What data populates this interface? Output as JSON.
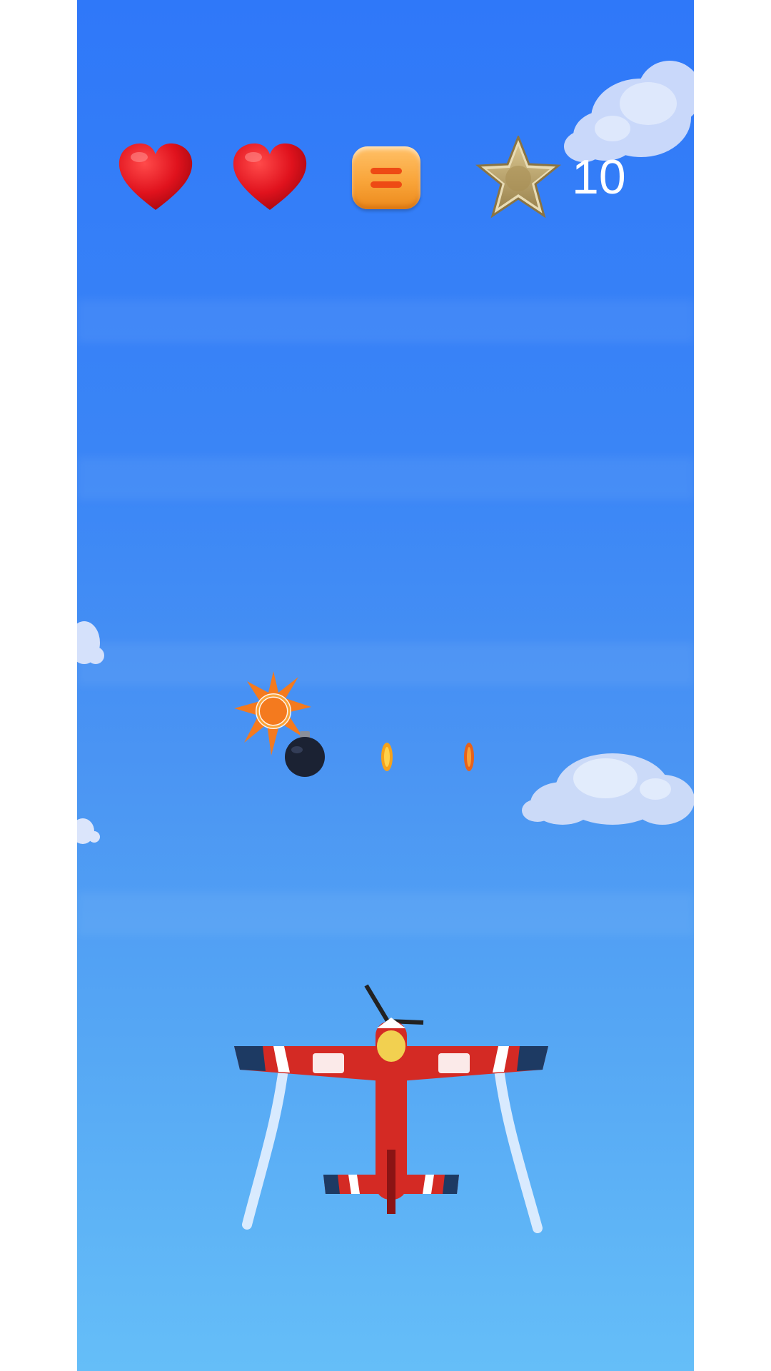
{
  "hud": {
    "lives": [
      {
        "name": "heart-icon-1"
      },
      {
        "name": "heart-icon-2"
      }
    ],
    "pause_icon": "pause-menu-icon",
    "star_icon": "star-badge-icon",
    "score": "10"
  },
  "colors": {
    "sky_top": "#2f78f9",
    "sky_bottom": "#65bef8",
    "heart": "#e0121d",
    "pause_button": "#f9a53a",
    "plane": "#d42a24"
  },
  "scene": {
    "player": "red-propeller-plane",
    "pickups": [
      "bomb",
      "coin",
      "coin"
    ],
    "effect": "explosion-burst"
  }
}
